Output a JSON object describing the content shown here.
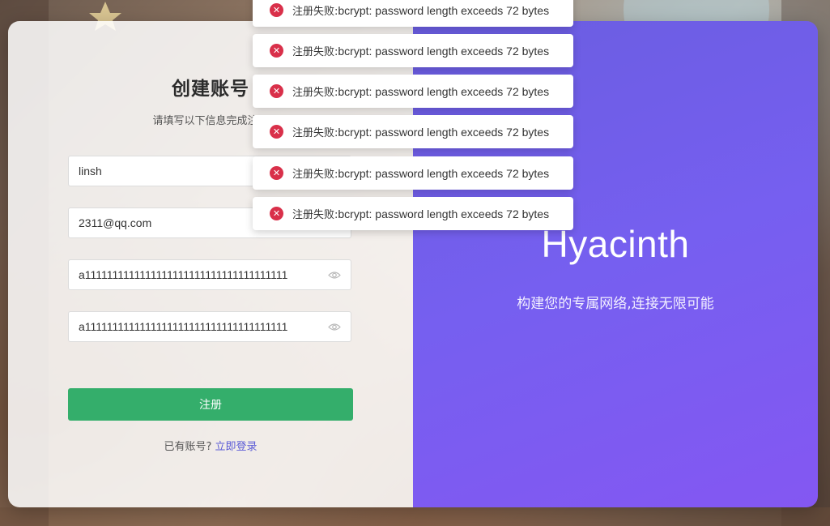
{
  "register": {
    "title": "创建账号",
    "subtitle": "请填写以下信息完成注册",
    "username_value": "linsh",
    "email_value": "2311@qq.com",
    "password_value": "a1111111111111111111111111111111111111",
    "confirm_password_value": "a1111111111111111111111111111111111111",
    "submit_label": "注册",
    "have_account_text": "已有账号?",
    "login_link": "立即登录"
  },
  "brand_panel": {
    "name": "Hyacinth",
    "tagline": "构建您的专属网络,连接无限可能"
  },
  "toasts": [
    {
      "prefix": "注册失败:",
      "message": "bcrypt: password length exceeds 72 bytes",
      "icon": "error-icon"
    },
    {
      "prefix": "注册失败:",
      "message": "bcrypt: password length exceeds 72 bytes",
      "icon": "error-icon"
    },
    {
      "prefix": "注册失败:",
      "message": "bcrypt: password length exceeds 72 bytes",
      "icon": "error-icon"
    },
    {
      "prefix": "注册失败:",
      "message": "bcrypt: password length exceeds 72 bytes",
      "icon": "error-icon"
    },
    {
      "prefix": "注册失败:",
      "message": "bcrypt: password length exceeds 72 bytes",
      "icon": "error-icon"
    },
    {
      "prefix": "注册失败:",
      "message": "bcrypt: password length exceeds 72 bytes",
      "icon": "error-icon"
    }
  ],
  "colors": {
    "submit_button": "#34ae6b",
    "brand_gradient_start": "#6a5de0",
    "brand_gradient_end": "#8457f2",
    "error": "#d9304a",
    "link": "#5b5bd6"
  }
}
